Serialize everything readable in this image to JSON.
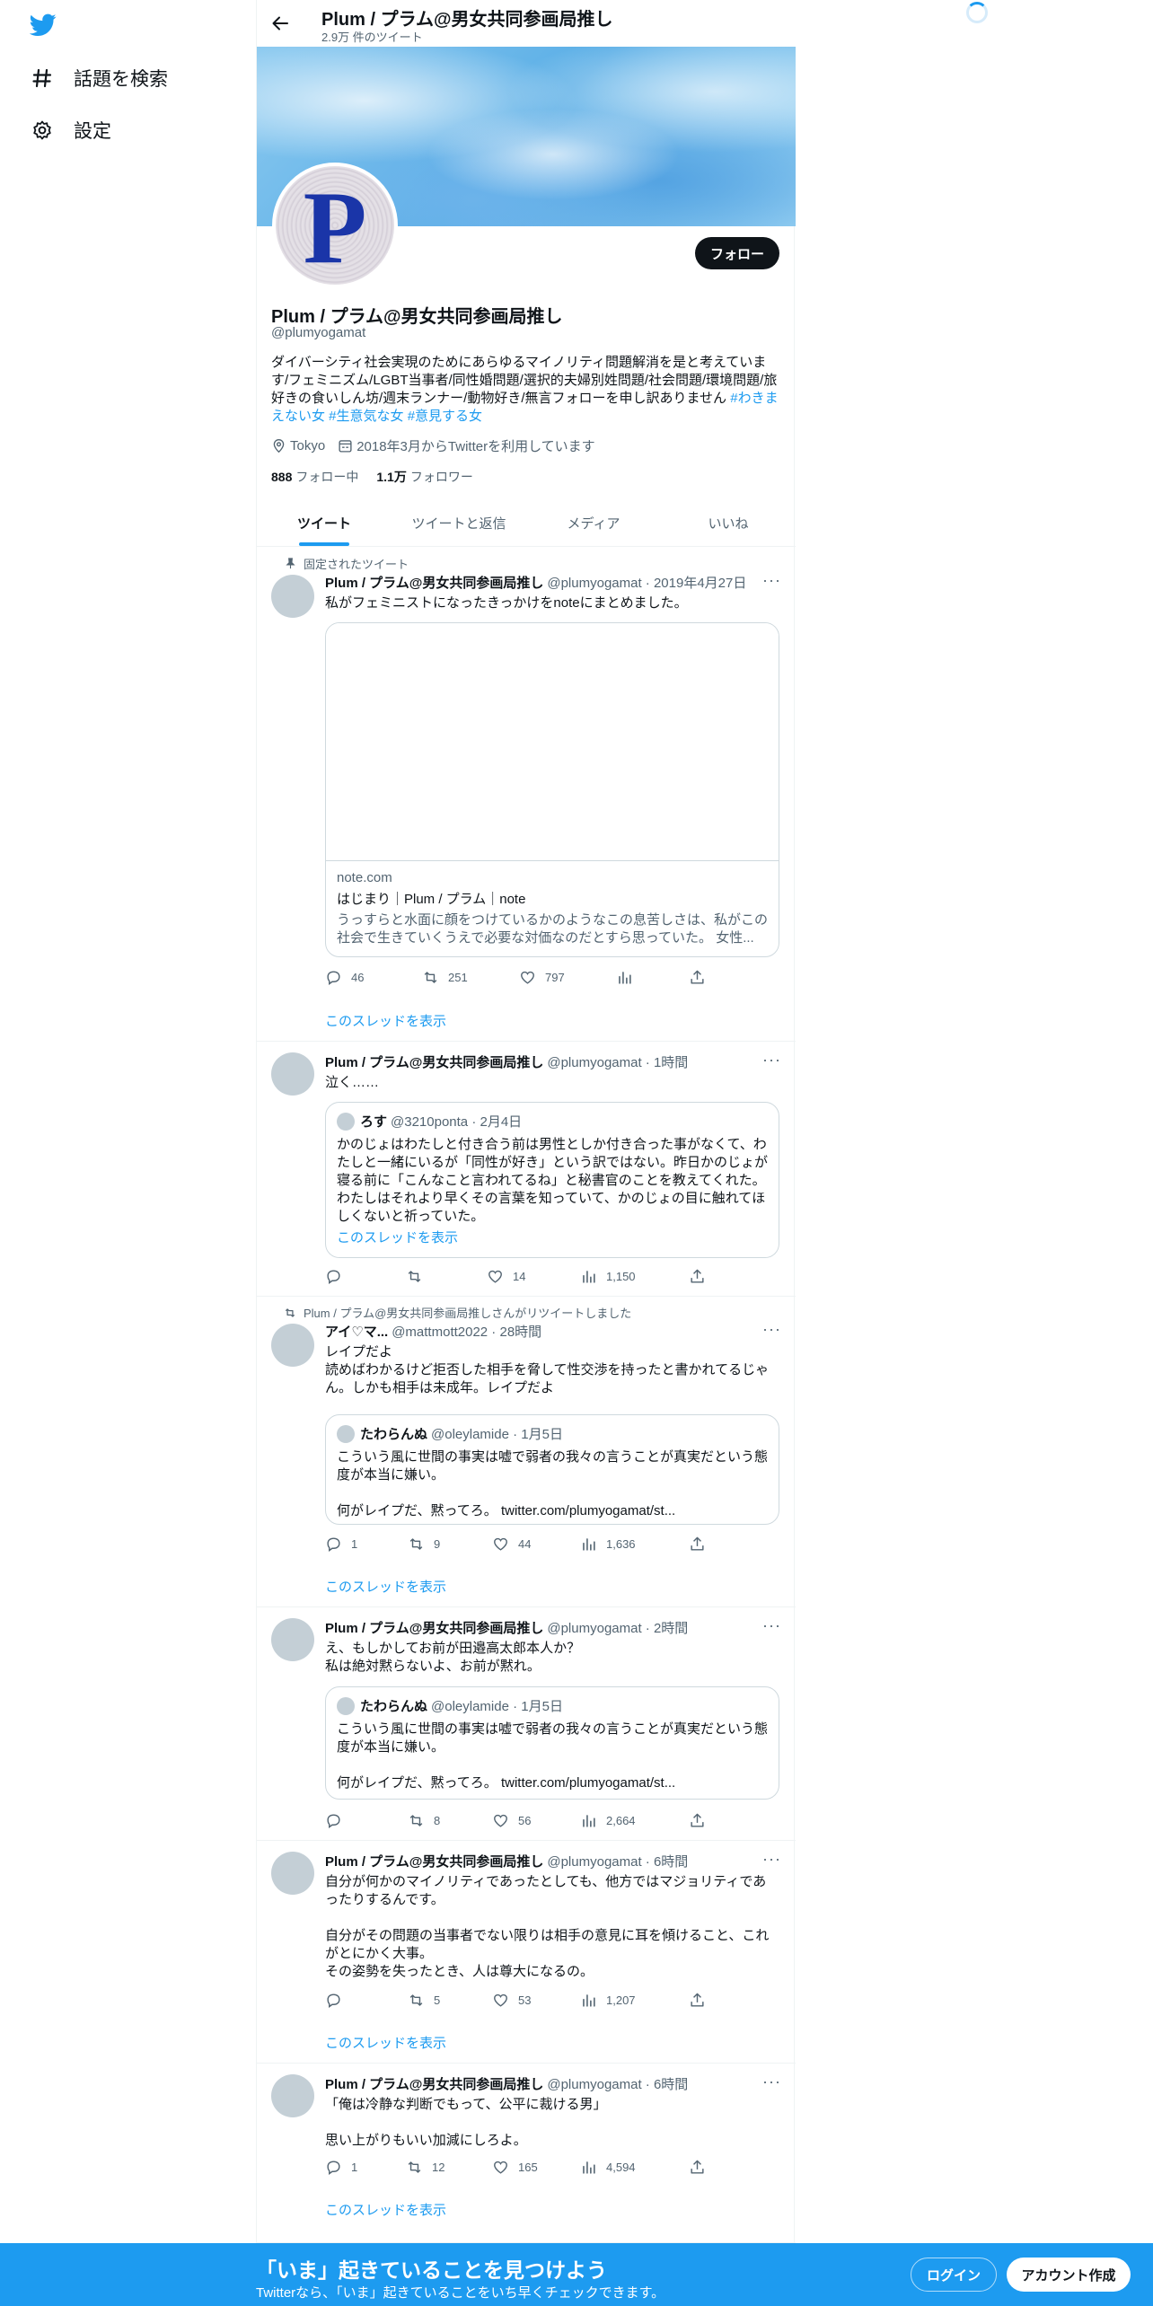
{
  "sidebar": {
    "logo_icon": "twitter-bird-icon",
    "items": [
      {
        "label": "話題を検索",
        "icon": "hashtag-icon"
      },
      {
        "label": "設定",
        "icon": "gear-icon"
      }
    ]
  },
  "header": {
    "name": "Plum / プラム@男女共同参画局推し",
    "tweet_count": "2.9万 件のツイート"
  },
  "profile": {
    "avatar_letter": "P",
    "follow_label": "フォロー",
    "name": "Plum / プラム@男女共同参画局推し",
    "handle": "@plumyogamat",
    "bio_line1": "ダイバーシティ社会実現のためにあらゆるマイノリティ問題解消を是と考えていま",
    "bio_line2": "す/フェミニズム/LGBT当事者/同性婚問題/選択的夫婦別姓問題/社会問題/環境問題/旅",
    "bio_line3": "好きの食いしん坊/週末ランナー/動物好き/無言フォローを申し訳ありません",
    "bio_tag1": " #わき",
    "bio_tag1b": "まえない女",
    "bio_tag2": " #生意気な女",
    "bio_tag3": " #意見する女",
    "location": "Tokyo",
    "joined": "2018年3月からTwitterを利用しています",
    "following_count": "888",
    "following_label": "フォロー中",
    "followers_count": "1.1万",
    "followers_label": "フォロワー"
  },
  "tabs": [
    "ツイート",
    "ツイートと返信",
    "メディア",
    "いいね"
  ],
  "tweets": [
    {
      "context": "固定されたツイート",
      "name": "Plum / プラム@男女共同参画局推し",
      "handle_time": "@plumyogamat · 2019年4月27日",
      "text": "私がフェミニストになったきっかけをnoteにまとめました。",
      "card": {
        "domain": "note.com",
        "title": "はじまり｜Plum / プラム｜note",
        "desc1": "うっすらと水面に顔をつけているかのようなこの息苦しさは、私がこの",
        "desc2": "社会で生きていくうえで必要な対価なのだとすら思っていた。 女性..."
      },
      "replies": "46",
      "retweets": "251",
      "likes": "797",
      "views": "",
      "show_thread": "このスレッドを表示"
    },
    {
      "name": "Plum / プラム@男女共同参画局推し",
      "handle_time": "@plumyogamat · 1時間",
      "text": "泣く……",
      "quote": {
        "name": "ろす",
        "handle_time": "@3210ponta · 2月4日",
        "text": "かのじょはわたしと付き合う前は男性としか付き合った事がなくて、わ\nたしと一緒にいるが「同性が好き」という訳ではない。昨日かのじょが\n寝る前に「こんなこと言われてるね」と秘書官のことを教えてくれた。\nわたしはそれより早くその言葉を知っていて、かのじょの目に触れてほ\nしくないと祈っていた。",
        "thread": "このスレッドを表示"
      },
      "replies": "",
      "retweets": "",
      "likes": "14",
      "views": "1,150"
    },
    {
      "context": "Plum / プラム@男女共同参画局推しさんがリツイートしました",
      "name": "アイ♡マ...",
      "handle_time": "@mattmott2022 · 28時間",
      "text": "レイプだよ\n読めばわかるけど拒否した相手を脅して性交渉を持ったと書かれてるじゃ\nん。しかも相手は未成年。レイプだよ",
      "quote": {
        "name": "たわらんぬ",
        "handle_time": "@oleylamide · 1月5日",
        "text": "こういう風に世間の事実は嘘で弱者の我々の言うことが真実だという態\n度が本当に嫌い。\n\n何がレイプだ、黙ってろ。 twitter.com/plumyogamat/st..."
      },
      "replies": "1",
      "retweets": "9",
      "likes": "44",
      "views": "1,636",
      "show_thread": "このスレッドを表示"
    },
    {
      "name": "Plum / プラム@男女共同参画局推し",
      "handle_time": "@plumyogamat · 2時間",
      "text": "え、もしかしてお前が田邉高太郎本人か？\n私は絶対黙らないよ、お前が黙れ。",
      "quote": {
        "name": "たわらんぬ",
        "handle_time": "@oleylamide · 1月5日",
        "text": "こういう風に世間の事実は嘘で弱者の我々の言うことが真実だという態\n度が本当に嫌い。\n\n何がレイプだ、黙ってろ。 twitter.com/plumyogamat/st..."
      },
      "replies": "",
      "retweets": "8",
      "likes": "56",
      "views": "2,664"
    },
    {
      "name": "Plum / プラム@男女共同参画局推し",
      "handle_time": "@plumyogamat · 6時間",
      "text": "自分が何かのマイノリティであったとしても、他方ではマジョリティであ\nったりするんです。\n\n自分がその問題の当事者でない限りは相手の意見に耳を傾けること、これ\nがとにかく大事。\nその姿勢を失ったとき、人は尊大になるの。",
      "replies": "",
      "retweets": "5",
      "likes": "53",
      "views": "1,207",
      "show_thread": "このスレッドを表示"
    },
    {
      "name": "Plum / プラム@男女共同参画局推し",
      "handle_time": "@plumyogamat · 6時間",
      "text": "「俺は冷静な判断でもって、公平に裁ける男」\n\n思い上がりもいい加減にしろよ。",
      "replies": "1",
      "retweets": "12",
      "likes": "165",
      "views": "4,594",
      "show_thread": "このスレッドを表示"
    }
  ],
  "bottom_bar": {
    "title": "「いま」起きていることを見つけよう",
    "subtitle": "Twitterなら、「いま」起きていることをいち早くチェックできます。",
    "login": "ログイン",
    "signup": "アカウント作成"
  },
  "colors": {
    "accent": "#1d9bf0",
    "text": "#0f1419",
    "secondary": "#536471",
    "border": "#eff3f4"
  }
}
